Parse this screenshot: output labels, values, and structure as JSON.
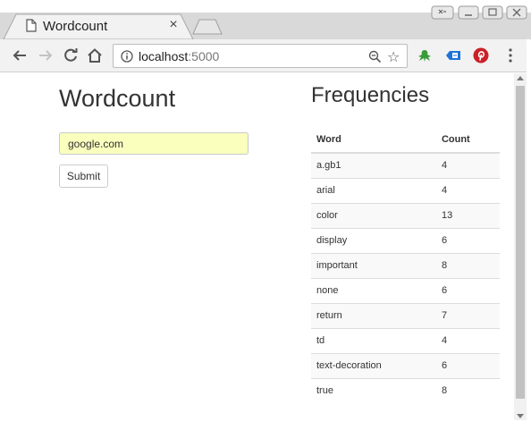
{
  "browser": {
    "tab": {
      "title": "Wordcount",
      "close_glyph": "×",
      "icon": "document-icon"
    },
    "window_controls": [
      "window-switch-icon",
      "minimize-icon",
      "maximize-icon",
      "close-icon"
    ],
    "toolbar": {
      "url_host": "localhost",
      "url_port": ":5000",
      "icons": [
        "back-arrow-icon",
        "forward-arrow-icon",
        "reload-icon",
        "home-icon",
        "site-info-icon",
        "zoom-out-icon",
        "bookmark-star-icon",
        "frog-extension-icon",
        "tag-extension-icon",
        "pinterest-extension-icon",
        "kebab-menu-icon"
      ],
      "star_glyph": "☆"
    }
  },
  "page": {
    "title": "Wordcount",
    "url_field": {
      "value": "google.com"
    },
    "submit_label": "Submit",
    "frequencies": {
      "title": "Frequencies",
      "headers": {
        "word": "Word",
        "count": "Count"
      },
      "rows": [
        {
          "word": "a.gb1",
          "count": "4"
        },
        {
          "word": "arial",
          "count": "4"
        },
        {
          "word": "color",
          "count": "13"
        },
        {
          "word": "display",
          "count": "6"
        },
        {
          "word": "important",
          "count": "8"
        },
        {
          "word": "none",
          "count": "6"
        },
        {
          "word": "return",
          "count": "7"
        },
        {
          "word": "td",
          "count": "4"
        },
        {
          "word": "text-decoration",
          "count": "6"
        },
        {
          "word": "true",
          "count": "8"
        }
      ]
    }
  },
  "colors": {
    "input_autofill_bg": "#faffbd",
    "pinterest_red": "#cb2027",
    "tag_blue": "#1e73d8",
    "frog_green": "#3a9a3a"
  }
}
